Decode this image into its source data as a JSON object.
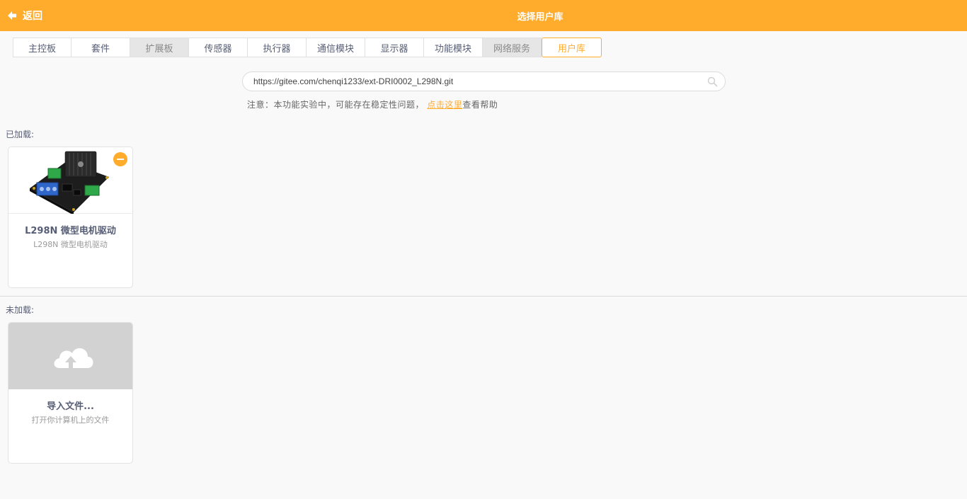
{
  "header": {
    "back_label": "返回",
    "title": "选择用户库",
    "color": "#ffab2b"
  },
  "tabs": [
    {
      "label": "主控板",
      "state": "normal"
    },
    {
      "label": "套件",
      "state": "normal"
    },
    {
      "label": "扩展板",
      "state": "disabled"
    },
    {
      "label": "传感器",
      "state": "normal"
    },
    {
      "label": "执行器",
      "state": "normal"
    },
    {
      "label": "通信模块",
      "state": "normal"
    },
    {
      "label": "显示器",
      "state": "normal"
    },
    {
      "label": "功能模块",
      "state": "normal"
    },
    {
      "label": "网络服务",
      "state": "disabled"
    },
    {
      "label": "用户库",
      "state": "active"
    }
  ],
  "search": {
    "value": "https://gitee.com/chenqi1233/ext-DRI0002_L298N.git",
    "icon": "search-icon"
  },
  "notice": {
    "prefix": "注意：本功能实验中，可能存在稳定性问题，",
    "link": "点击这里",
    "suffix": "查看帮助"
  },
  "loaded": {
    "label": "已加载:",
    "items": [
      {
        "title": "L298N 微型电机驱动",
        "subtitle": "L298N 微型电机驱动"
      }
    ]
  },
  "unloaded": {
    "label": "未加载:",
    "items": [
      {
        "title": "导入文件...",
        "subtitle": "打开你计算机上的文件",
        "icon": "cloud-upload-icon"
      }
    ]
  }
}
